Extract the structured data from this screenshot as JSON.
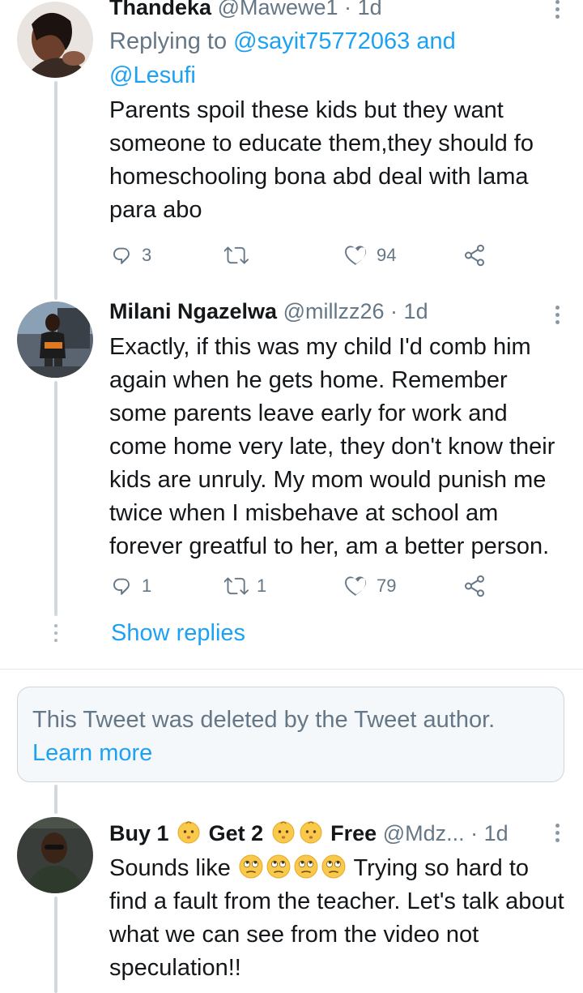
{
  "tweets": [
    {
      "name": "Thandeka",
      "handle": "@Mawewe1",
      "sep": "·",
      "time": "1d",
      "reply_prefix": "Replying to ",
      "reply_mention1": "@sayit75772063",
      "reply_and": " and",
      "reply_mention2": "@Lesufi",
      "body": "Parents  spoil these kids but they want someone to educate them,they should fo homeschooling bona abd deal with lama para abo",
      "replies": "3",
      "retweets": "",
      "likes": "94"
    },
    {
      "name": "Milani Ngazelwa",
      "handle": "@millzz26",
      "sep": "·",
      "time": "1d",
      "body": "Exactly, if this was my child I'd comb him again when he gets home. Remember some parents leave early for work and come home very late, they don't know their kids are unruly. My mom would punish me twice when I misbehave at school am forever greatful to her, am a better person.",
      "replies": "1",
      "retweets": "1",
      "likes": "79"
    },
    {
      "name_part1": "Buy 1",
      "name_part2": "Get 2",
      "name_part3": "Free",
      "handle": "@Mdz...",
      "sep": "·",
      "time": "1d",
      "body_prefix": "Sounds like",
      "body_rest": " Trying so hard to find a fault from the teacher. Let's talk about what we can see from the video not speculation!!"
    }
  ],
  "show_replies": "Show replies",
  "deleted": {
    "message": "This Tweet was deleted by the Tweet author.",
    "link": "Learn more"
  },
  "icons": {
    "reply": "reply-icon",
    "retweet": "retweet-icon",
    "like": "heart-icon",
    "share": "share-icon",
    "more": "more-vertical-icon",
    "emoji_baby": "baby-emoji",
    "emoji_rolling_eyes": "rolling-eyes-emoji"
  },
  "colors": {
    "accent": "#1da1f2",
    "secondary_text": "#657786",
    "thread_line": "#cfd9de"
  }
}
